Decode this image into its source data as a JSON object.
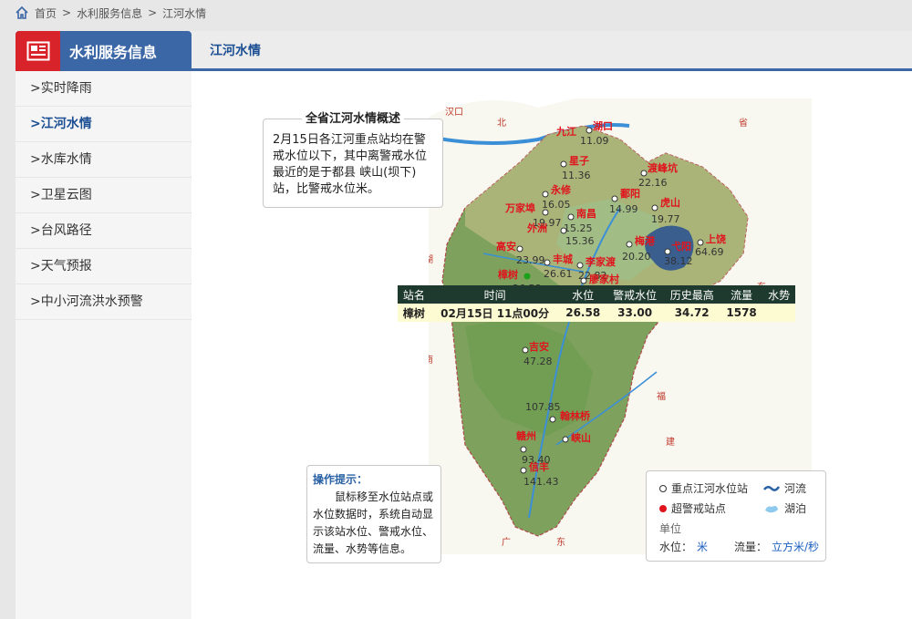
{
  "breadcrumb": {
    "items": [
      "首页",
      "水利服务信息",
      "江河水情"
    ],
    "separator": ">"
  },
  "sidebar": {
    "title": "水利服务信息",
    "items": [
      {
        "label": "实时降雨",
        "active": false
      },
      {
        "label": "江河水情",
        "active": true
      },
      {
        "label": "水库水情",
        "active": false
      },
      {
        "label": "卫星云图",
        "active": false
      },
      {
        "label": "台风路径",
        "active": false
      },
      {
        "label": "天气预报",
        "active": false
      },
      {
        "label": "中小河流洪水预警",
        "active": false
      }
    ]
  },
  "tab": {
    "label": "江河水情"
  },
  "summary": {
    "title": "全省江河水情概述",
    "text": "2月15日各江河重点站均在警戒水位以下，其中离警戒水位最近的是于都县 峡山(坝下)站，比警戒水位米。"
  },
  "tip": {
    "title": "操作提示：",
    "body": "鼠标移至水位站点或水位数据时，系统自动显示该站水位、警戒水位、流量、水势等信息。"
  },
  "legend": {
    "key_station": "重点江河水位站",
    "river": "河流",
    "over_warning": "超警戒站点",
    "lake": "湖泊",
    "unit_title": "单位",
    "water_level_label": "水位：",
    "water_level_unit": "米",
    "flow_label": "流量：",
    "flow_unit": "立方米/秒"
  },
  "table": {
    "headers": [
      "站名",
      "时间",
      "水位",
      "警戒水位",
      "历史最高",
      "流量",
      "水势"
    ],
    "row": [
      "樟树",
      "02月15日 11点00分",
      "26.58",
      "33.00",
      "34.72",
      "1578",
      ""
    ]
  },
  "map": {
    "outer_labels": [
      "汉口",
      "北",
      "湖",
      "南",
      "省",
      "东",
      "福",
      "建",
      "省",
      "广",
      "东"
    ],
    "stations": [
      {
        "name": "九江",
        "value": ""
      },
      {
        "name": "湖口",
        "value": "11.09"
      },
      {
        "name": "星子",
        "value": "11.36"
      },
      {
        "name": "渡峰坑",
        "value": "22.16"
      },
      {
        "name": "永修",
        "value": "16.05"
      },
      {
        "name": "万家埠",
        "value": "19.97"
      },
      {
        "name": "南昌",
        "value": "15.25"
      },
      {
        "name": "鄱阳",
        "value": "14.99"
      },
      {
        "name": "虎山",
        "value": "19.77"
      },
      {
        "name": "外洲",
        "value": "15.36"
      },
      {
        "name": "梅港",
        "value": "20.20"
      },
      {
        "name": "弋阳",
        "value": "38.12"
      },
      {
        "name": "上饶",
        "value": "64.69"
      },
      {
        "name": "高安",
        "value": "23.99"
      },
      {
        "name": "丰城",
        "value": "26.61"
      },
      {
        "name": "李家渡",
        "value": "22.82"
      },
      {
        "name": "樟树",
        "value": "26.58"
      },
      {
        "name": "廖家村",
        "value": ""
      },
      {
        "name": "吉安",
        "value": "47.28"
      },
      {
        "name": "翰林桥",
        "value": "107.85"
      },
      {
        "name": "峡山",
        "value": ""
      },
      {
        "name": "赣州",
        "value": "93.40"
      },
      {
        "name": "信丰",
        "value": "141.43"
      }
    ]
  },
  "colors": {
    "accent": "#3c67a6",
    "icon_red": "#d9232a",
    "station_red": "#e0141c",
    "table_header": "#1e3a2e",
    "table_row": "#fdfbd2"
  }
}
